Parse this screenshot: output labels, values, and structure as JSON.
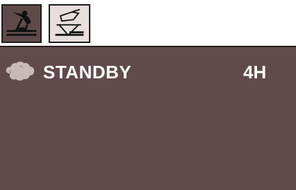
{
  "tabs": [
    {
      "icon": "wet-floor-mopping-icon",
      "active": true
    },
    {
      "icon": "ironing-board-icon",
      "active": false
    }
  ],
  "status": {
    "icon": "cloud-icon",
    "label": "STANDBY",
    "value": "4H"
  },
  "colors": {
    "panel": "#614a4b",
    "active_tab": "#5f4a4a",
    "inactive_tab": "#e8dede",
    "text": "#ffffff"
  }
}
